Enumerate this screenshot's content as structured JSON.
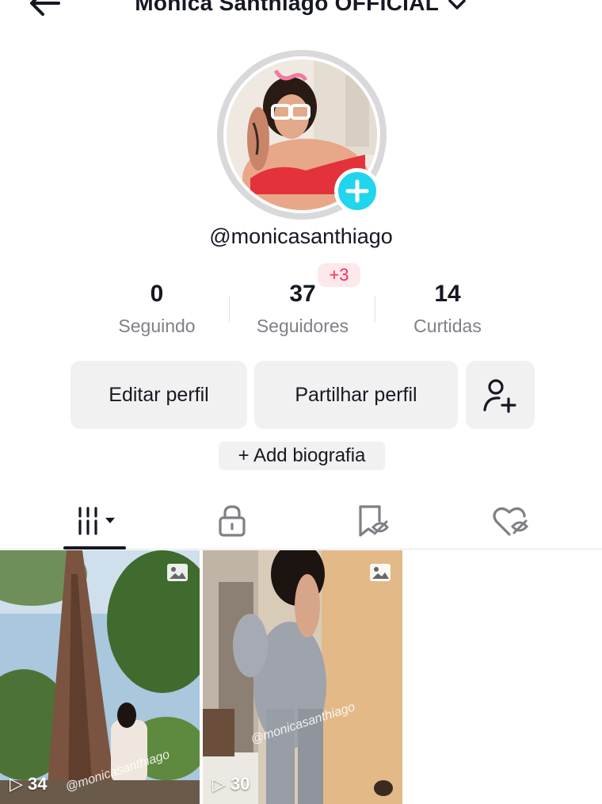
{
  "header": {
    "title": "Monica Santhiago OFFICIAL"
  },
  "profile": {
    "handle": "@monicasanthiago"
  },
  "stats": {
    "following_count": "0",
    "following_label": "Seguindo",
    "followers_count": "37",
    "followers_label": "Seguidores",
    "followers_delta": "+3",
    "likes_count": "14",
    "likes_label": "Curtidas"
  },
  "actions": {
    "edit_label": "Editar perfil",
    "share_label": "Partilhar perfil",
    "bio_label": "+ Add biografia"
  },
  "tabs": [
    {
      "name": "videos",
      "icon": "grid-icon"
    },
    {
      "name": "private",
      "icon": "lock-icon"
    },
    {
      "name": "favorites",
      "icon": "bookmark-hidden-icon"
    },
    {
      "name": "liked",
      "icon": "heart-hidden-icon"
    }
  ],
  "posts": [
    {
      "views": "34",
      "watermark": "@monicasanthiago",
      "type_icon": "photo-icon"
    },
    {
      "views": "30",
      "watermark": "@monicasanthiago",
      "type_icon": "photo-icon"
    }
  ],
  "colors": {
    "accent_plus": "#20d5ec",
    "delta_text": "#fe2c55",
    "delta_bg": "#fde8ec",
    "button_bg": "#f1f1f2",
    "text": "#161823",
    "muted": "#7f7f86"
  }
}
